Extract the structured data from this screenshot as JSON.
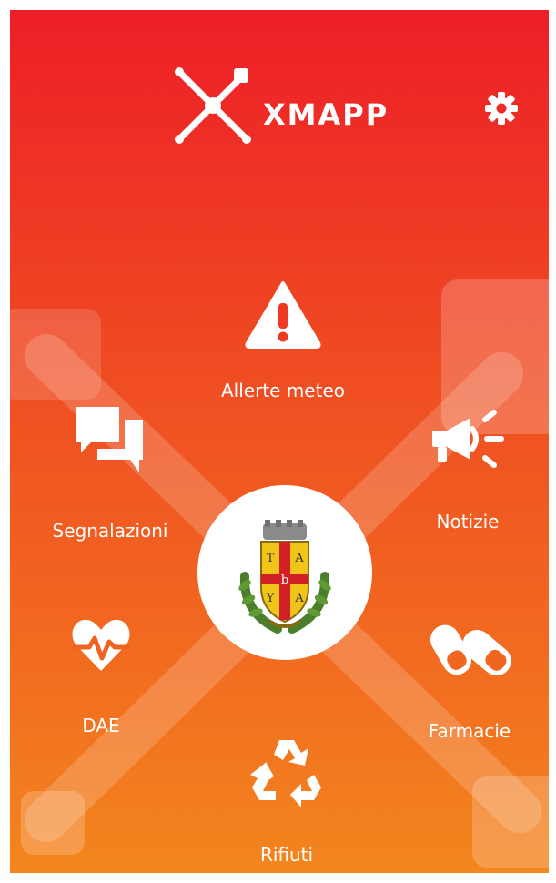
{
  "app": {
    "logo_text": "XMAPP",
    "logo_icon": "xmapp-logo-icon",
    "settings_icon": "gear-icon"
  },
  "emblem": {
    "icon": "municipal-coat-of-arms",
    "letters": [
      "T",
      "A",
      "b",
      "Y",
      "A"
    ]
  },
  "menu": {
    "allerte_meteo": {
      "label": "Allerte meteo",
      "icon": "warning-icon"
    },
    "segnalazioni": {
      "label": "Segnalazioni",
      "icon": "chat-icon"
    },
    "notizie": {
      "label": "Notizie",
      "icon": "megaphone-icon"
    },
    "dae": {
      "label": "DAE",
      "icon": "heart-pulse-icon"
    },
    "farmacie": {
      "label": "Farmacie",
      "icon": "pills-icon"
    },
    "rifiuti": {
      "label": "Rifiuti",
      "icon": "recycle-icon"
    }
  },
  "colors": {
    "gradient_top": "#ee1e27",
    "gradient_bottom": "#f3861e",
    "foreground": "#ffffff"
  }
}
